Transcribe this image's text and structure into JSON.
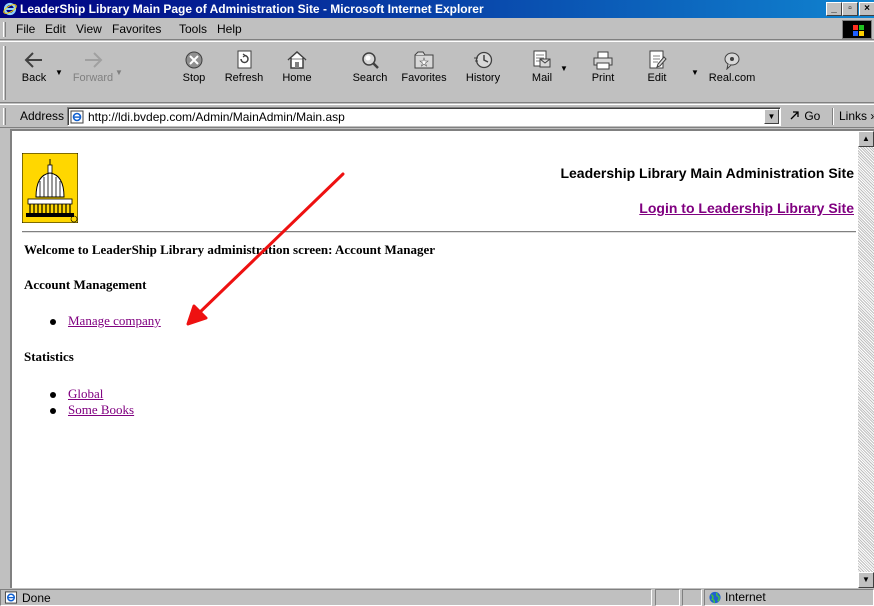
{
  "window": {
    "title": "LeaderShip Library Main Page of Administration Site - Microsoft Internet Explorer"
  },
  "menu": {
    "items": [
      "File",
      "Edit",
      "View",
      "Favorites",
      "Tools",
      "Help"
    ]
  },
  "toolbar": {
    "back": "Back",
    "forward": "Forward",
    "stop": "Stop",
    "refresh": "Refresh",
    "home": "Home",
    "search": "Search",
    "favorites": "Favorites",
    "history": "History",
    "mail": "Mail",
    "print": "Print",
    "edit": "Edit",
    "realcom": "Real.com"
  },
  "address": {
    "label": "Address",
    "url": "http://ldi.bvdep.com/Admin/MainAdmin/Main.asp",
    "go": "Go",
    "links": "Links"
  },
  "page": {
    "site_title": "Leadership Library Main Administration Site",
    "login_link": "Login to Leadership Library Site",
    "welcome": "Welcome to LeaderShip Library administration screen: Account Manager",
    "account_heading": "Account Management",
    "account_links": [
      "Manage company"
    ],
    "stats_heading": "Statistics",
    "stats_links": [
      "Global",
      "Some Books"
    ]
  },
  "status": {
    "text": "Done",
    "zone": "Internet"
  },
  "colors": {
    "visited_link": "#800080",
    "title_bar": "#000080",
    "annotation_arrow": "#ee1111",
    "logo_bg": "#ffd700"
  }
}
